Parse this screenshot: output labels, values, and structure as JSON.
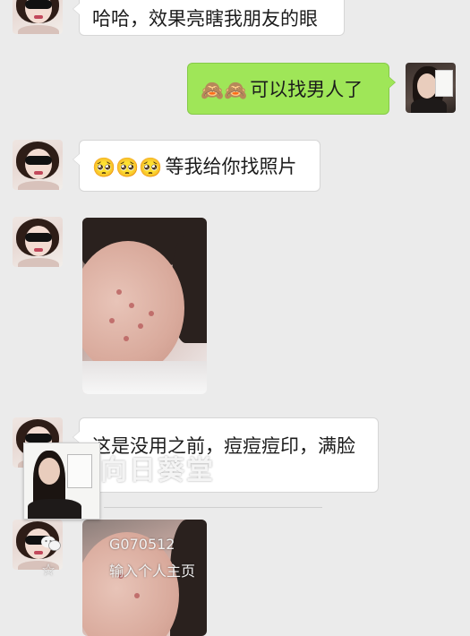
{
  "messages": [
    {
      "text": "哈哈，效果亮瞎我朋友的眼"
    },
    {
      "emoji": "🙈🙈",
      "text": "可以找男人了"
    },
    {
      "emoji": "🥺🥺🥺",
      "text": "等我给你找照片"
    },
    {
      "text": "这是没用之前，痘痘痘印，满脸"
    }
  ],
  "watermark": {
    "title": "向日葵堂",
    "id": "G070512",
    "hint": "输入个人主页"
  },
  "colors": {
    "background": "#ebebeb",
    "outgoing_bubble": "#9fe658",
    "incoming_bubble": "#ffffff"
  },
  "icons": [
    "wechat-icon",
    "star-icon",
    "pasted-photo-placeholder"
  ]
}
